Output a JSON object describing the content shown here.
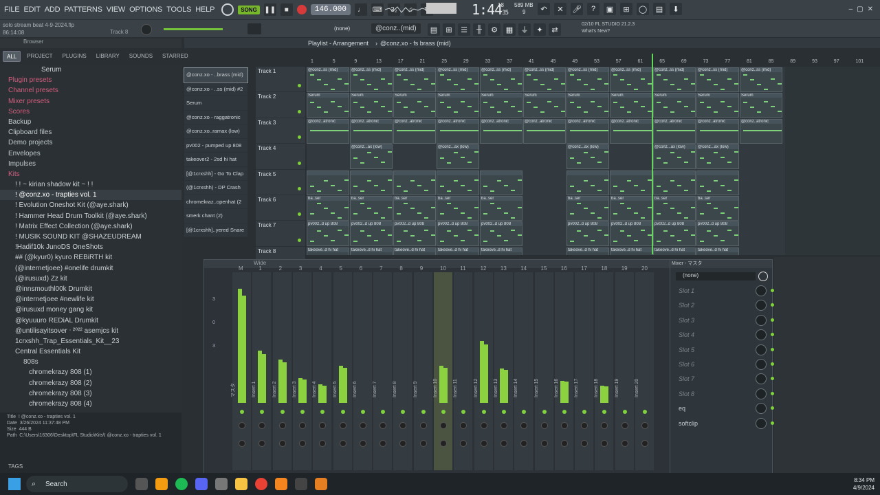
{
  "menu": [
    "FILE",
    "EDIT",
    "ADD",
    "PATTERNS",
    "VIEW",
    "OPTIONS",
    "TOOLS",
    "HELP"
  ],
  "transport": {
    "mode": "SONG",
    "tempo": "146.000",
    "time": "1:44",
    "time_small": "35"
  },
  "cpu": {
    "ram": "589 MB",
    "poly": "18",
    "poly2": "9"
  },
  "project": {
    "file": "solo stream beat 4-9-2024.flp",
    "pos": "86:14:08",
    "track_label": "Track 8"
  },
  "hint": {
    "version": "FL STUDIO 21.2.3",
    "whats_new": "What's New?",
    "date": "02/10"
  },
  "pattern_select": "(none)",
  "pattern_name": "@conz..(mid)",
  "browser": {
    "title": "Browser",
    "tabs": [
      "ALL",
      "PROJECT",
      "PLUGINS",
      "LIBRARY",
      "SOUNDS",
      "STARRED"
    ],
    "header": "Serum",
    "items": [
      {
        "label": "Plugin presets",
        "type": "hd"
      },
      {
        "label": "Channel presets",
        "type": "hd"
      },
      {
        "label": "Mixer presets",
        "type": "hd"
      },
      {
        "label": "Scores",
        "type": "hd"
      },
      {
        "label": "Backup",
        "type": "fd"
      },
      {
        "label": "Clipboard files",
        "type": "fd"
      },
      {
        "label": "Demo projects",
        "type": "fd"
      },
      {
        "label": "Envelopes",
        "type": "fd"
      },
      {
        "label": "Impulses",
        "type": "fd"
      },
      {
        "label": "Kits",
        "type": "hd"
      },
      {
        "label": "! ! ~ kirian shadow kit ~ ! !",
        "type": "kt"
      },
      {
        "label": "! @conz.xo - trapties vol. 1",
        "type": "kt sel"
      },
      {
        "label": "! Evolution Oneshot Kit (@aye.shark)",
        "type": "kt"
      },
      {
        "label": "! Hammer Head Drum Toolkit (@aye.shark)",
        "type": "kt"
      },
      {
        "label": "! Matrix Effect Collection (@aye.shark)",
        "type": "kt"
      },
      {
        "label": "! MUSIK SOUND KIT @SHAZEUDREAM",
        "type": "kt"
      },
      {
        "label": "!Hadif10k JunoDS OneShots",
        "type": "kt"
      },
      {
        "label": "## (@kyur0) kyuro REBiRTH kit",
        "type": "kt"
      },
      {
        "label": "(@internetjoee) #onelife drumkit",
        "type": "kt"
      },
      {
        "label": "(@irusuxd) Zz kit",
        "type": "kt"
      },
      {
        "label": "@innsmouthl00k Drumkit",
        "type": "kt"
      },
      {
        "label": "@internetjoee #newlife kit",
        "type": "kt"
      },
      {
        "label": "@irusuxd money gang kit",
        "type": "kt"
      },
      {
        "label": "@kyuuuro REDiAL Drumkit",
        "type": "kt"
      },
      {
        "label": "@untilisayitsover ᐧ ²⁰²² asemjcs kit",
        "type": "kt"
      },
      {
        "label": "1crxshh_Trap_Essentials_Kit__23",
        "type": "kt"
      },
      {
        "label": "Central Essentials Kit",
        "type": "kt"
      },
      {
        "label": "808s",
        "type": "sub"
      },
      {
        "label": "chromekrazy 808 (1)",
        "type": "f808"
      },
      {
        "label": "chromekrazy 808 (2)",
        "type": "f808"
      },
      {
        "label": "chromekrazy 808 (3)",
        "type": "f808"
      },
      {
        "label": "chromekrazy 808 (4)",
        "type": "f808"
      }
    ],
    "info": {
      "title": "! @conz.xo - trapties vol. 1",
      "date": "3/26/2024 11:37:48 PM",
      "size": "444 B",
      "path": "C:\\Users\\16306\\Desktop\\FL Studio\\Kits\\! @conz.xo - trapties vol. 1"
    },
    "tags_label": "TAGS"
  },
  "playlist": {
    "title": "Playlist - Arrangement",
    "breadcrumb": "@conz.xo - fs brass (mid)",
    "ruler": [
      "1",
      "5",
      "9",
      "13",
      "17",
      "21",
      "25",
      "29",
      "33",
      "37",
      "41",
      "45",
      "49",
      "53",
      "57",
      "61",
      "65",
      "69",
      "73",
      "77",
      "81",
      "85",
      "89",
      "93",
      "97",
      "101"
    ],
    "patterns": [
      "@conz.xo - ..brass (mid)",
      "@conz.xo - ..ss (mid) #2",
      "Serum",
      "@conz.xo - raggatronic",
      "@conz.xo..ramax (low)",
      "pv002 - pumped up 808",
      "takeover2 - 2sd hi hat",
      "[@1crxshh] - Go To Clap",
      "(@1crxshh) - DP Crash",
      "chromekraz..openhat (2",
      "smerk chant (2)",
      "[@1crxshh]..yered Snare"
    ],
    "tracks": [
      "Track 1",
      "Track 2",
      "Track 3",
      "Track 4",
      "Track 5",
      "Track 6",
      "Track 7",
      "Track 8"
    ],
    "clip_labels": [
      "@conz..ss (mid)",
      "Serum",
      "@conz..atronic",
      "@conz...ax (low)",
      "",
      "ba..ser",
      "pv002..d up 808",
      "takeove..d hi hat"
    ]
  },
  "mixer": {
    "title": "Wide",
    "slot_title": "Mixer - マスタ",
    "preset": "(none)",
    "master_label": "マスタ",
    "strips": [
      "Insert 1",
      "Insert 2",
      "Insert 3",
      "Insert 4",
      "Insert 5",
      "Insert 6",
      "Insert 7",
      "Insert 8",
      "Insert 9",
      "Insert 10",
      "Insert 11",
      "Insert 12",
      "Insert 13",
      "Insert 14",
      "Insert 15",
      "Insert 16",
      "Insert 17",
      "Insert 18",
      "Insert 19",
      "Insert 20"
    ],
    "insert_numbers": [
      "M",
      "1",
      "2",
      "3",
      "4",
      "5",
      "6",
      "7",
      "8",
      "9",
      "10",
      "11",
      "12",
      "13",
      "14",
      "15",
      "16",
      "17",
      "18",
      "19",
      "20"
    ],
    "levels": [
      0.92,
      0.42,
      0.35,
      0.2,
      0.15,
      0.3,
      0,
      0,
      0,
      0,
      0.3,
      0,
      0.5,
      0.28,
      0,
      0,
      0.18,
      0,
      0.14,
      0,
      0
    ],
    "selected_index": 10,
    "scale": [
      "3",
      "0",
      "3"
    ],
    "slots": [
      "Slot 1",
      "Slot 2",
      "Slot 3",
      "Slot 4",
      "Slot 5",
      "Slot 6",
      "Slot 7",
      "Slot 8",
      "eq",
      "softclip"
    ]
  },
  "taskbar": {
    "search": "Search",
    "time": "8:34 PM",
    "date": "4/9/2024"
  }
}
